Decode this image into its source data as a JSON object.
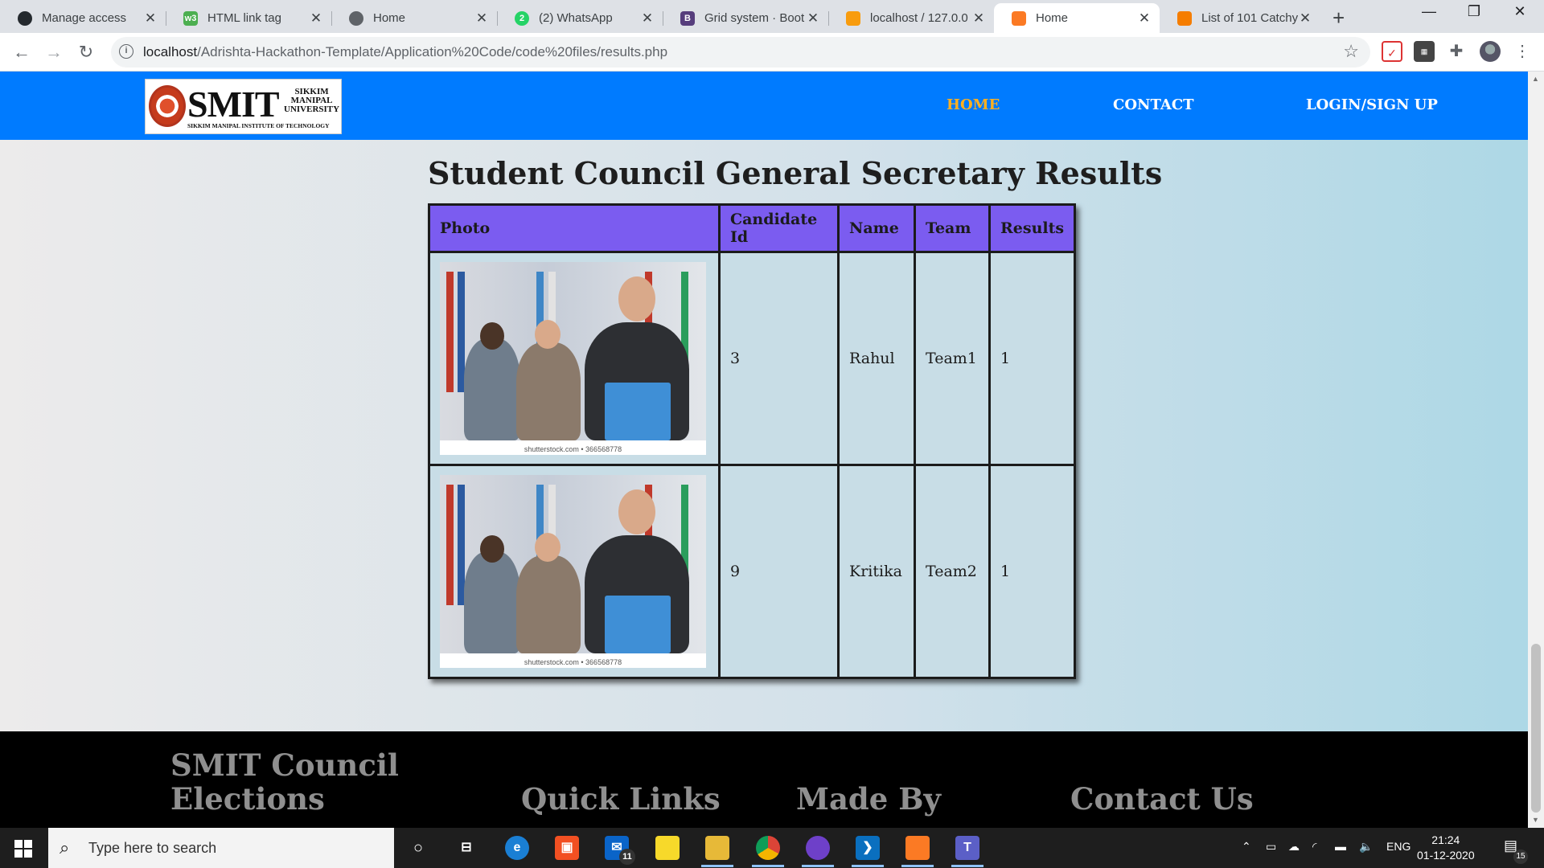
{
  "browser": {
    "tabs": [
      {
        "title": "Manage access",
        "icon": "github-icon",
        "color": "#24292e"
      },
      {
        "title": "HTML link tag",
        "icon": "w3schools-icon",
        "color": "#4caf50"
      },
      {
        "title": "Home",
        "icon": "globe-icon",
        "color": "#5f6368"
      },
      {
        "title": "(2) WhatsApp",
        "icon": "whatsapp-icon",
        "color": "#25d366",
        "badge": "2"
      },
      {
        "title": "Grid system · Boot",
        "icon": "bootstrap-icon",
        "color": "#563d7c",
        "badge": "B"
      },
      {
        "title": "localhost / 127.0.0",
        "icon": "phpmyadmin-icon",
        "color": "#f89c0e"
      },
      {
        "title": "Home",
        "icon": "xampp-icon",
        "color": "#fb7a24",
        "active": true
      },
      {
        "title": "List of 101 Catchy",
        "icon": "blogger-icon",
        "color": "#f57d00"
      }
    ],
    "url_host": "localhost",
    "url_path": "/Adrishta-Hackathon-Template/Application%20Code/code%20files/results.php",
    "new_tab_label": "+",
    "info_label": "i"
  },
  "site": {
    "logo": {
      "word": "SMIT",
      "university_lines": [
        "SIKKIM",
        "MANIPAL",
        "UNIVERSITY"
      ],
      "institute": "SIKKIM MANIPAL INSTITUTE OF TECHNOLOGY"
    },
    "nav": {
      "home": "HOME",
      "contact": "CONTACT",
      "login": "LOGIN/SIGN UP"
    },
    "accent_color": "#007bff",
    "active_nav_color": "#ffb020"
  },
  "results": {
    "title": "Student Council General Secretary Results",
    "columns": [
      "Photo",
      "Candidate Id",
      "Name",
      "Team",
      "Results"
    ],
    "rows": [
      {
        "candidate_id": "3",
        "name": "Rahul",
        "team": "Team1",
        "result": "1",
        "photo_credit": "shutterstock.com • 366568778"
      },
      {
        "candidate_id": "9",
        "name": "Kritika",
        "team": "Team2",
        "result": "1",
        "photo_credit": "shutterstock.com • 366568778"
      }
    ],
    "header_color": "#7b5cf0"
  },
  "footer": {
    "brand_line1": "SMIT Council",
    "brand_line2": "Elections",
    "quick_links": "Quick Links",
    "made_by": "Made By",
    "contact_us": "Contact Us"
  },
  "taskbar": {
    "search_placeholder": "Type here to search",
    "mail_badge": "11",
    "language": "ENG",
    "time": "21:24",
    "date": "01-12-2020",
    "notification_count": "15"
  }
}
